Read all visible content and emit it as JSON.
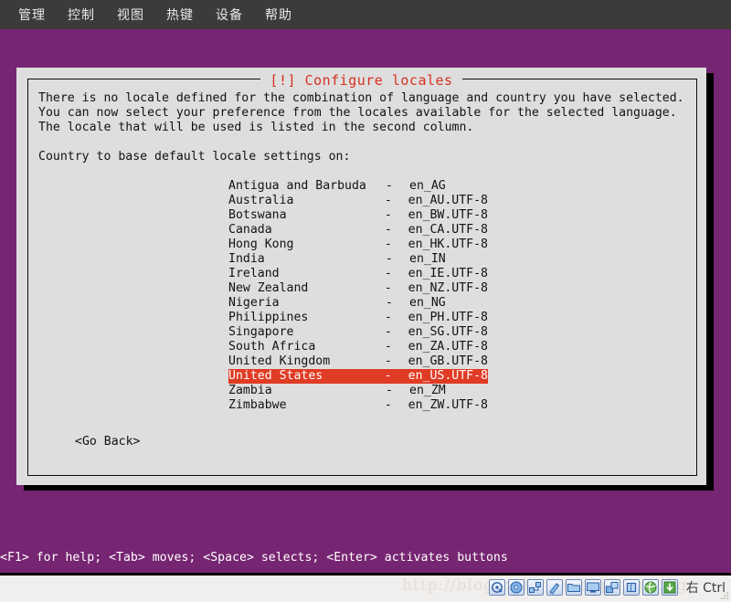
{
  "menubar": {
    "items": [
      {
        "label": "管理",
        "name": "menu-manage"
      },
      {
        "label": "控制",
        "name": "menu-control"
      },
      {
        "label": "视图",
        "name": "menu-view"
      },
      {
        "label": "热键",
        "name": "menu-hotkey"
      },
      {
        "label": "设备",
        "name": "menu-devices"
      },
      {
        "label": "帮助",
        "name": "menu-help"
      }
    ]
  },
  "dialog": {
    "title": "[!] Configure locales",
    "paragraph": [
      "There is no locale defined for the combination of language and country you have selected.",
      "You can now select your preference from the locales available for the selected language.",
      "The locale that will be used is listed in the second column."
    ],
    "prompt": "Country to base default locale settings on:",
    "dash": "-",
    "list": [
      {
        "country": "Antigua and Barbuda",
        "locale": "en_AG",
        "selected": false
      },
      {
        "country": "Australia",
        "locale": "en_AU.UTF-8",
        "selected": false
      },
      {
        "country": "Botswana",
        "locale": "en_BW.UTF-8",
        "selected": false
      },
      {
        "country": "Canada",
        "locale": "en_CA.UTF-8",
        "selected": false
      },
      {
        "country": "Hong Kong",
        "locale": "en_HK.UTF-8",
        "selected": false
      },
      {
        "country": "India",
        "locale": "en_IN",
        "selected": false
      },
      {
        "country": "Ireland",
        "locale": "en_IE.UTF-8",
        "selected": false
      },
      {
        "country": "New Zealand",
        "locale": "en_NZ.UTF-8",
        "selected": false
      },
      {
        "country": "Nigeria",
        "locale": "en_NG",
        "selected": false
      },
      {
        "country": "Philippines",
        "locale": "en_PH.UTF-8",
        "selected": false
      },
      {
        "country": "Singapore",
        "locale": "en_SG.UTF-8",
        "selected": false
      },
      {
        "country": "South Africa",
        "locale": "en_ZA.UTF-8",
        "selected": false
      },
      {
        "country": "United Kingdom",
        "locale": "en_GB.UTF-8",
        "selected": false
      },
      {
        "country": "United States",
        "locale": "en_US.UTF-8",
        "selected": true
      },
      {
        "country": "Zambia",
        "locale": "en_ZM",
        "selected": false
      },
      {
        "country": "Zimbabwe",
        "locale": "en_ZW.UTF-8",
        "selected": false
      }
    ],
    "go_back": "<Go Back>"
  },
  "helpline": "<F1> for help; <Tab> moves; <Space> selects; <Enter> activates buttons",
  "statusbar": {
    "watermark": "http://blog.csdn.net/sujiangming",
    "host_key": "右 Ctrl",
    "icons": [
      {
        "name": "hard-disk-icon"
      },
      {
        "name": "optical-disk-icon"
      },
      {
        "name": "network-adapter-icon"
      },
      {
        "name": "usb-icon"
      },
      {
        "name": "shared-folder-icon"
      },
      {
        "name": "display-icon"
      },
      {
        "name": "shared-clipboard-icon"
      },
      {
        "name": "processor-icon"
      },
      {
        "name": "network-globe-icon"
      },
      {
        "name": "guest-additions-icon"
      }
    ]
  },
  "colors": {
    "desktop_purple": "#762572",
    "menubar_gray": "#3b3b39",
    "dialog_bg": "#dedede",
    "title_red": "#d83021",
    "highlight_red": "#e03b24",
    "statusbar_bg": "#f0efed"
  }
}
